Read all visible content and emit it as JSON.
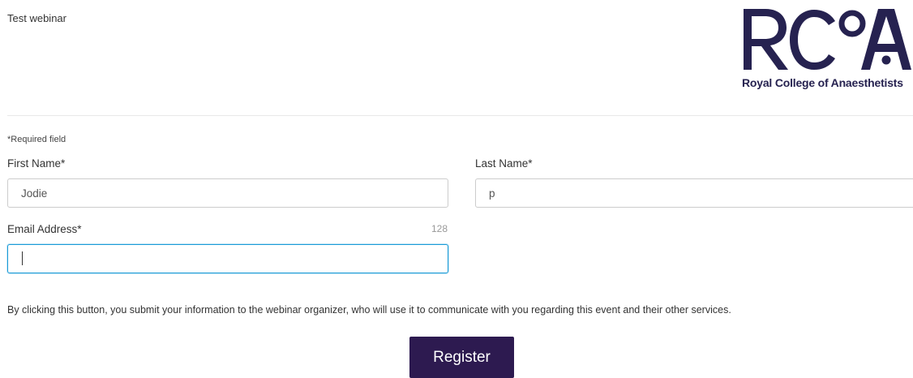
{
  "webinar": {
    "title": "Test webinar"
  },
  "logo": {
    "name": "rcoa-logo",
    "letters": "RCoA",
    "tagline": "Royal College of Anaesthetists",
    "color": "#262250"
  },
  "form": {
    "required_note": "*Required field",
    "first_name": {
      "label": "First Name*",
      "value": "Jodie"
    },
    "last_name": {
      "label": "Last Name*",
      "value": "p"
    },
    "email": {
      "label": "Email Address*",
      "value": "",
      "remaining_chars": "128",
      "focused": true
    }
  },
  "disclaimer": "By clicking this button, you submit your information to the webinar organizer, who will use it to communicate with you regarding this event and their other services.",
  "register_button": {
    "label": "Register",
    "color": "#2d1a50"
  },
  "colors": {
    "focus_border": "#1a9bd7",
    "divider": "#e9e9e9"
  }
}
